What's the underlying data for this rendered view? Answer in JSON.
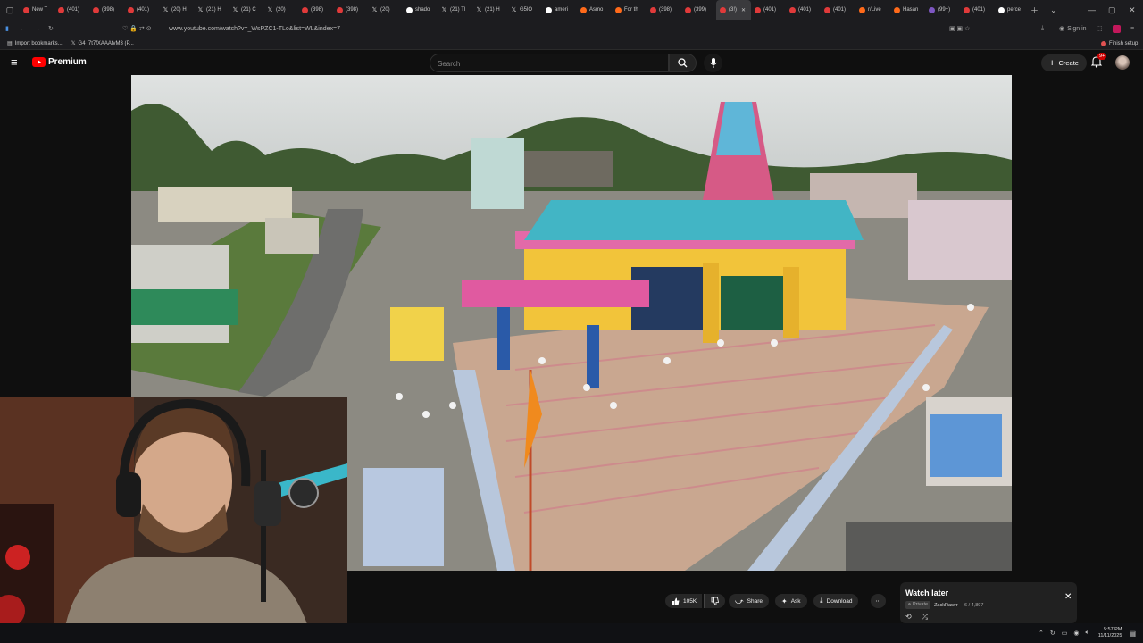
{
  "browser": {
    "tabs": [
      {
        "label": "New T",
        "icon": "generic"
      },
      {
        "label": "(401)",
        "icon": "youtube"
      },
      {
        "label": "(398)",
        "icon": "youtube"
      },
      {
        "label": "(401)",
        "icon": "youtube"
      },
      {
        "label": "(20) H",
        "icon": "x"
      },
      {
        "label": "(21) H",
        "icon": "x"
      },
      {
        "label": "(21) C",
        "icon": "x"
      },
      {
        "label": "(20) ",
        "icon": "x"
      },
      {
        "label": "(398)",
        "icon": "youtube"
      },
      {
        "label": "(398)",
        "icon": "youtube"
      },
      {
        "label": "(20) ",
        "icon": "x"
      },
      {
        "label": "shado",
        "icon": "chatgpt"
      },
      {
        "label": "(21) Tl",
        "icon": "x"
      },
      {
        "label": "(21) H",
        "icon": "x"
      },
      {
        "label": "G5lO",
        "icon": "x"
      },
      {
        "label": "ameri",
        "icon": "google"
      },
      {
        "label": "Asmo",
        "icon": "reddit"
      },
      {
        "label": "For th",
        "icon": "reddit"
      },
      {
        "label": "(398)",
        "icon": "youtube"
      },
      {
        "label": "(399)",
        "icon": "youtube"
      },
      {
        "label": "(3!)",
        "icon": "youtube",
        "active": true
      },
      {
        "label": "(401)",
        "icon": "youtube"
      },
      {
        "label": "(401)",
        "icon": "youtube"
      },
      {
        "label": "(401)",
        "icon": "youtube"
      },
      {
        "label": "r/Live",
        "icon": "reddit"
      },
      {
        "label": "Hasan",
        "icon": "reddit"
      },
      {
        "label": "(99+)",
        "icon": "twitch"
      },
      {
        "label": "(401)",
        "icon": "youtube"
      },
      {
        "label": "perce",
        "icon": "google"
      }
    ],
    "url": "www.youtube.com/watch?v=_WsPZC1-TLo&list=WL&index=7",
    "bookmarks": [
      "Import bookmarks...",
      "G4_7t7fXAAAfvM3 (P..."
    ],
    "finish_setup": "Finish setup",
    "sign_in": "Sign in"
  },
  "youtube": {
    "logo": "Premium",
    "search_placeholder": "Search",
    "create": "Create",
    "notif_badge": "9+"
  },
  "actions": {
    "likes": "105K",
    "share": "Share",
    "ask": "Ask",
    "download": "Download"
  },
  "watch_later": {
    "title": "Watch later",
    "privacy": "Private",
    "owner": "ZackRawrr",
    "position": "- 6 / 4,897"
  },
  "taskbar": {
    "time": "5:57 PM",
    "date": "11/11/2025"
  },
  "colors": {
    "youtube_red": "#ff0000",
    "chrome_bg": "#1c1c1f",
    "page_bg": "#0f0f0f"
  }
}
